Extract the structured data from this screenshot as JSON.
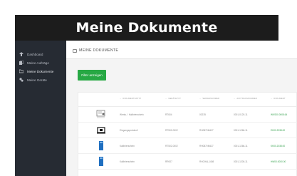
{
  "banner": {
    "title": "Meine Dokumente"
  },
  "sidebar": {
    "items": [
      {
        "label": "Dashboard",
        "icon": "dashboard-icon"
      },
      {
        "label": "Meine Aufträge",
        "icon": "orders-icon"
      },
      {
        "label": "Meine Dokumente",
        "icon": "documents-icon"
      },
      {
        "label": "Meine Geräte",
        "icon": "devices-icon"
      }
    ]
  },
  "header": {
    "page_title": "MEINE DOKUMENTE"
  },
  "filter_button": {
    "label": "Filter anzeigen"
  },
  "table": {
    "columns": [
      "DOKUMENTENTYP",
      "GERÄTETYP",
      "SERIENNUMMER",
      "AUFTRAGSNUMMER",
      "DOKUMENT"
    ],
    "rows": [
      {
        "type": "Werks- / Kalibrierschein",
        "device": "RT604",
        "serial": "00235",
        "order": "0001-0120-11",
        "document": "WKS00.0008.64",
        "thumb": "certificate"
      },
      {
        "type": "Eingangsprotokoll",
        "device": "RT502-0002",
        "serial": "RH0870M427",
        "order": "0001-1266-11",
        "document": "EK00.2038.00",
        "thumb": "device-photo"
      },
      {
        "type": "Kalibrierschein",
        "device": "RT502-0002",
        "serial": "RH0870M427",
        "order": "0001-1266-11",
        "document": "KK00.2038.00",
        "thumb": "blue-doc"
      },
      {
        "type": "Kalibrierschein",
        "device": "RR007",
        "serial": "RHCHAL1408",
        "order": "0001-1200-11",
        "document": "HW00.0000.00",
        "thumb": "blue-doc"
      }
    ]
  },
  "colors": {
    "sidebar": "#262b33",
    "accent": "#27a844",
    "banner": "#1c1c1c"
  }
}
